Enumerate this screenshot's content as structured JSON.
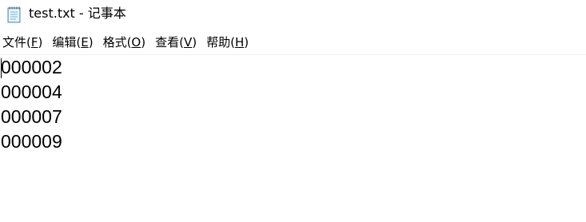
{
  "window": {
    "title": "test.txt - 记事本",
    "icon": "notepad-icon"
  },
  "menu": {
    "items": [
      {
        "label": "文件(F)",
        "accel": "F"
      },
      {
        "label": "编辑(E)",
        "accel": "E"
      },
      {
        "label": "格式(O)",
        "accel": "O"
      },
      {
        "label": "查看(V)",
        "accel": "V"
      },
      {
        "label": "帮助(H)",
        "accel": "H"
      }
    ]
  },
  "document": {
    "lines": [
      "000002",
      "000004",
      "000007",
      "000009"
    ]
  }
}
